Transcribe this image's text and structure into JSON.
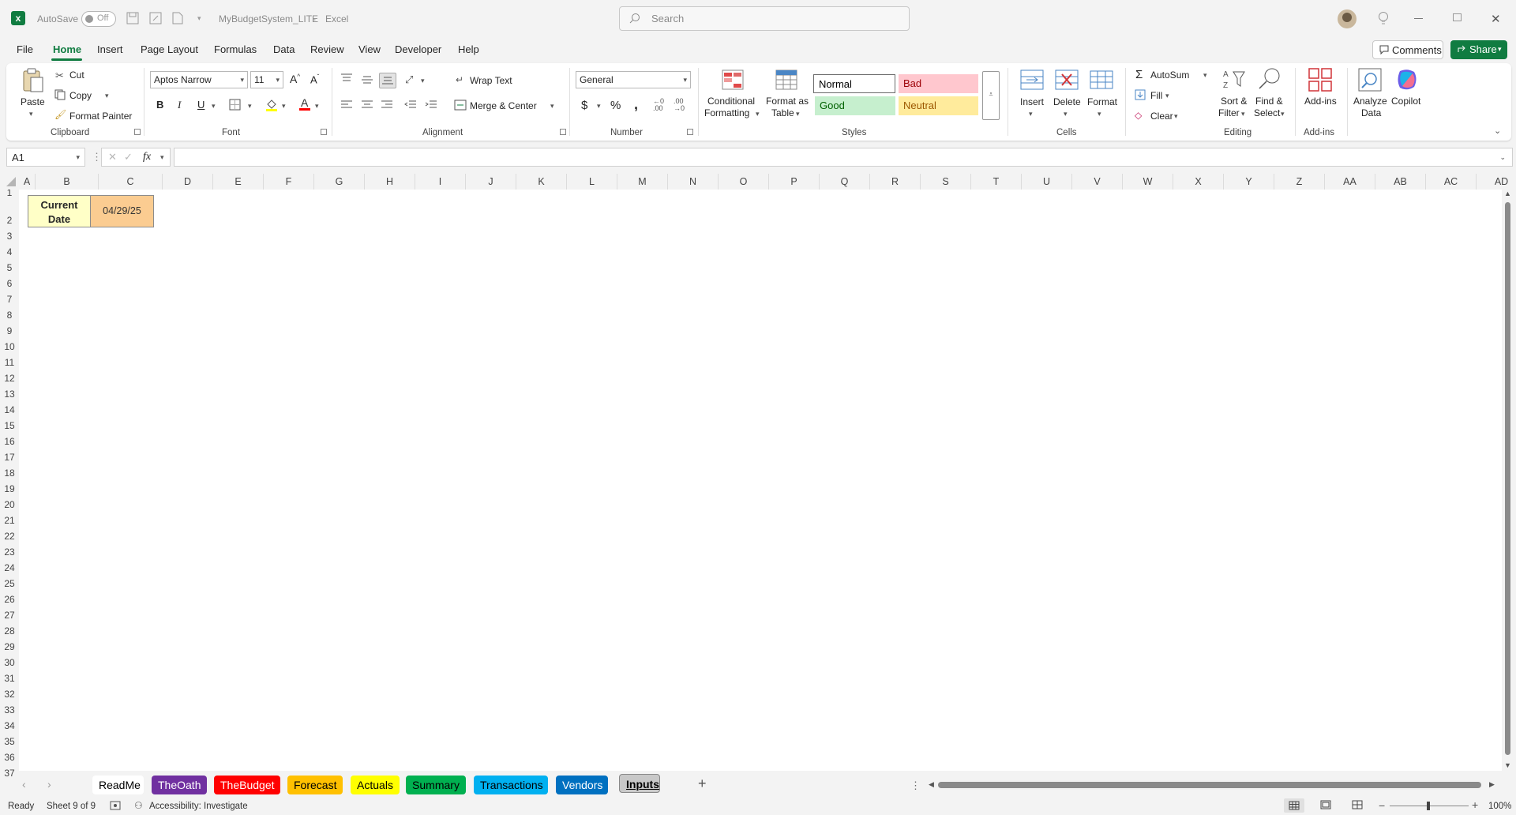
{
  "titlebar": {
    "autosave_label": "AutoSave",
    "autosave_state": "Off",
    "doc_title": "MyBudgetSystem_LITE",
    "app_name": "Excel",
    "search_placeholder": "Search"
  },
  "menu": {
    "items": [
      "File",
      "Home",
      "Insert",
      "Page Layout",
      "Formulas",
      "Data",
      "Review",
      "View",
      "Developer",
      "Help"
    ],
    "active": "Home",
    "comments_label": "Comments",
    "share_label": "Share"
  },
  "ribbon": {
    "clipboard": {
      "paste": "Paste",
      "cut": "Cut",
      "copy": "Copy",
      "format_painter": "Format Painter",
      "group": "Clipboard"
    },
    "font": {
      "family": "Aptos Narrow",
      "size": "11",
      "bold": "B",
      "italic": "I",
      "underline": "U",
      "group": "Font"
    },
    "alignment": {
      "wrap_text": "Wrap Text",
      "merge_center": "Merge & Center",
      "group": "Alignment"
    },
    "number": {
      "format": "General",
      "group": "Number"
    },
    "styles": {
      "conditional_1": "Conditional",
      "conditional_2": "Formatting",
      "format_table_1": "Format as",
      "format_table_2": "Table",
      "normal": "Normal",
      "bad": "Bad",
      "good": "Good",
      "neutral": "Neutral",
      "group": "Styles"
    },
    "cells": {
      "insert": "Insert",
      "delete": "Delete",
      "format": "Format",
      "group": "Cells"
    },
    "editing": {
      "autosum": "AutoSum",
      "fill": "Fill",
      "clear": "Clear",
      "sort_1": "Sort &",
      "sort_2": "Filter",
      "find_1": "Find &",
      "find_2": "Select",
      "group": "Editing"
    },
    "addins": {
      "addins": "Add-ins",
      "group": "Add-ins"
    },
    "analyze": {
      "label_1": "Analyze",
      "label_2": "Data"
    },
    "copilot": {
      "label": "Copilot"
    }
  },
  "formula_bar": {
    "name_box": "A1",
    "fx": "fx",
    "content": ""
  },
  "columns": [
    "A",
    "B",
    "C",
    "D",
    "E",
    "F",
    "G",
    "H",
    "I",
    "J",
    "K",
    "L",
    "M",
    "N",
    "O",
    "P",
    "Q",
    "R",
    "S",
    "T",
    "U",
    "V",
    "W",
    "X",
    "Y",
    "Z",
    "AA",
    "AB",
    "AC",
    "AD"
  ],
  "rows": [
    "1",
    "2",
    "3",
    "4",
    "5",
    "6",
    "7",
    "8",
    "9",
    "10",
    "11",
    "12",
    "13",
    "14",
    "15",
    "16",
    "17",
    "18",
    "19",
    "20",
    "21",
    "22",
    "23",
    "24",
    "25",
    "26",
    "27",
    "28",
    "29",
    "30",
    "31",
    "32",
    "33",
    "34",
    "35",
    "36",
    "37"
  ],
  "cells": {
    "b2_line1": "Current",
    "b2_line2": "Date",
    "c2": "04/29/25"
  },
  "sheet_tabs": [
    {
      "name": "ReadMe",
      "bg": "#ffffff",
      "fg": "#000000"
    },
    {
      "name": "TheOath",
      "bg": "#7030a0",
      "fg": "#ffffff"
    },
    {
      "name": "TheBudget",
      "bg": "#ff0000",
      "fg": "#ffffff"
    },
    {
      "name": "Forecast",
      "bg": "#ffc000",
      "fg": "#000000"
    },
    {
      "name": "Actuals",
      "bg": "#ffff00",
      "fg": "#000000"
    },
    {
      "name": "Summary",
      "bg": "#00b050",
      "fg": "#000000"
    },
    {
      "name": "Transactions",
      "bg": "#00b0f0",
      "fg": "#000000"
    },
    {
      "name": "Vendors",
      "bg": "#0070c0",
      "fg": "#ffffff"
    },
    {
      "name": "Inputs",
      "bg": "#c8c8c8",
      "fg": "#000000"
    }
  ],
  "active_sheet": "Inputs",
  "status": {
    "ready": "Ready",
    "sheet_count": "Sheet 9 of 9",
    "accessibility": "Accessibility: Investigate",
    "zoom": "100%"
  },
  "colors": {
    "excel_green": "#107c41",
    "accent_share": "#107c41"
  }
}
